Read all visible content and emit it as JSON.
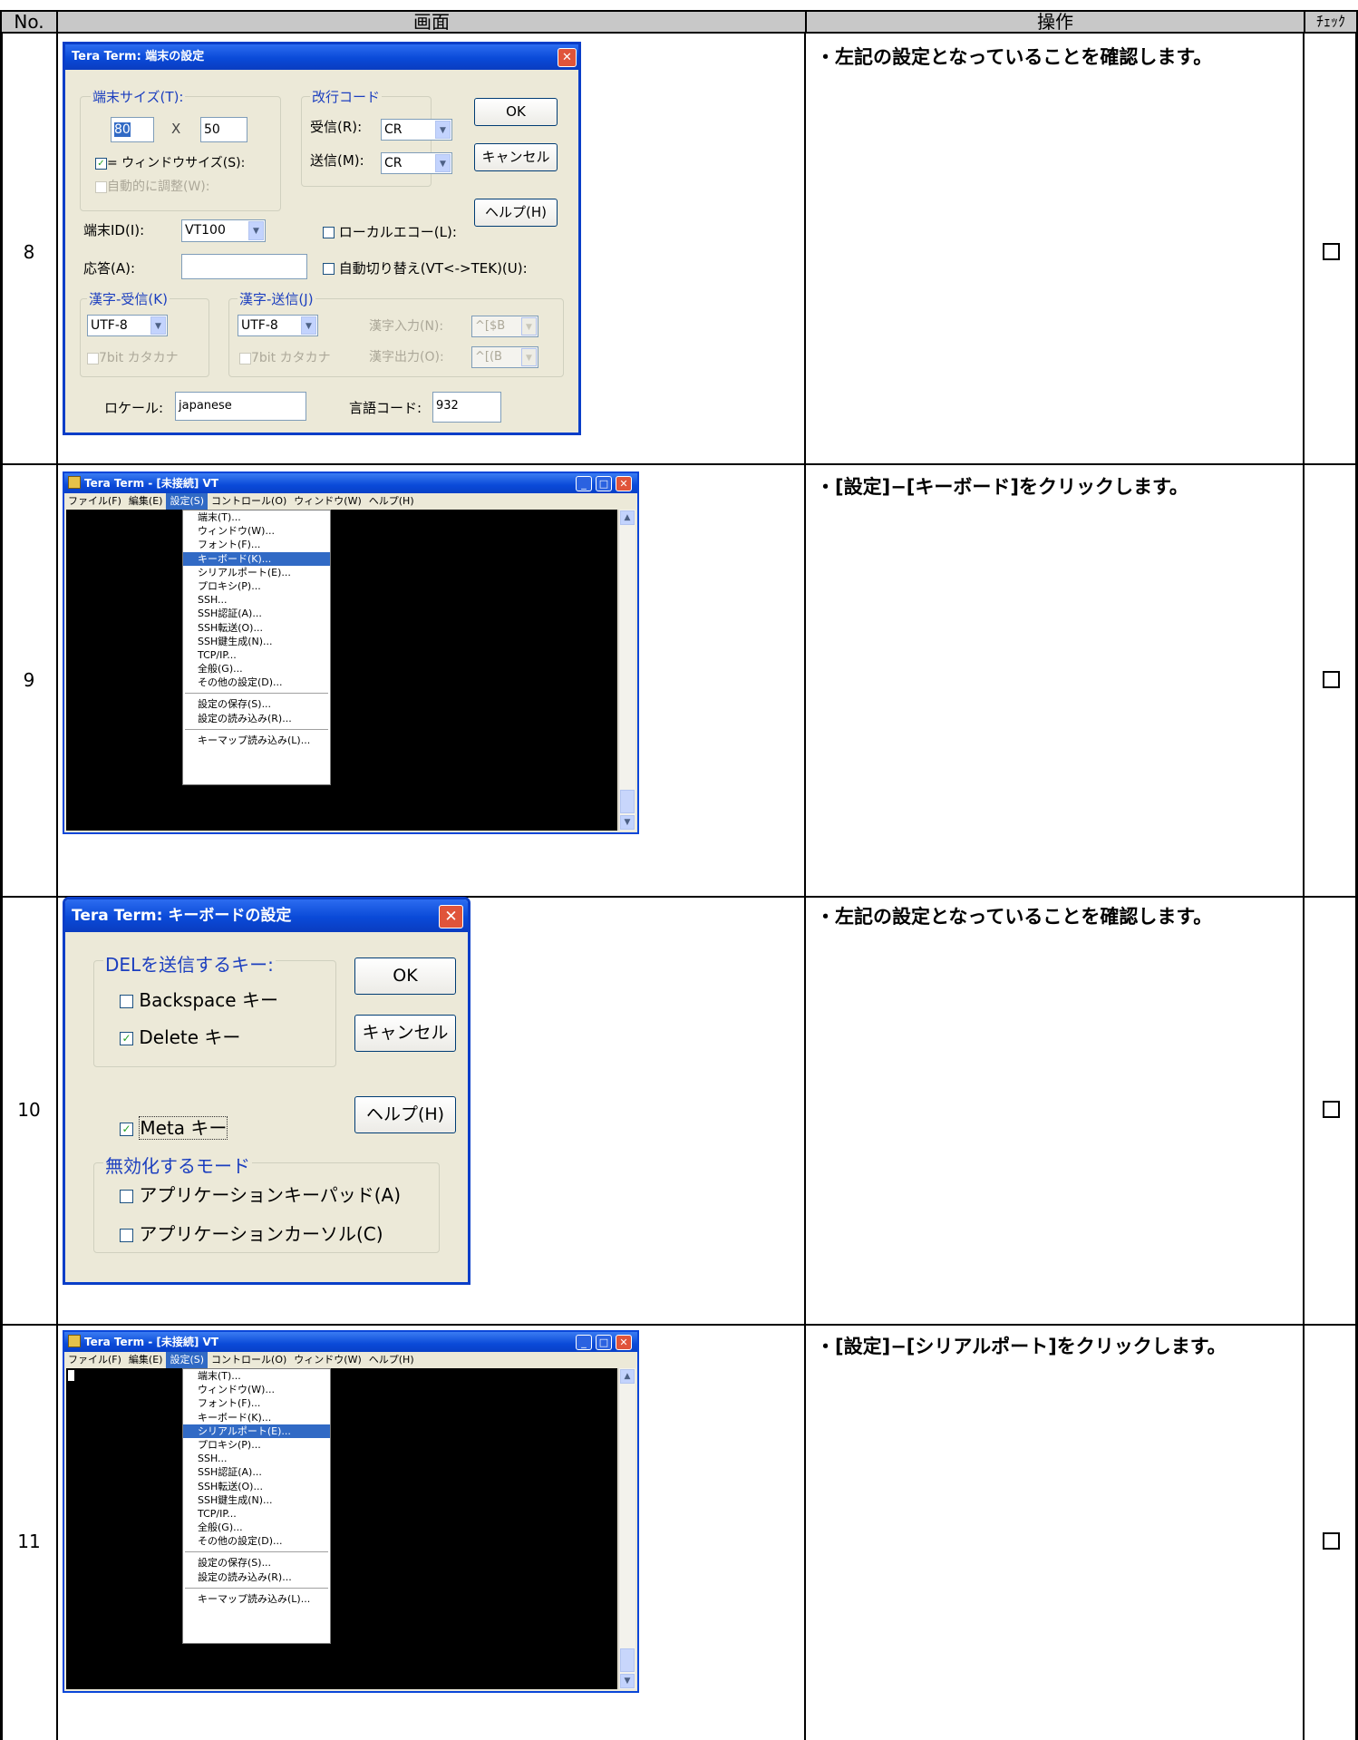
{
  "header": {
    "no": "No.",
    "screen": "画面",
    "operation": "操作",
    "check": "ﾁｪｯｸ"
  },
  "rows": [
    {
      "no": "8",
      "note": "・左記の設定となっていることを確認します。",
      "check": "□"
    },
    {
      "no": "9",
      "note": "・[設定]−[キーボード]をクリックします。",
      "check": "□"
    },
    {
      "no": "10",
      "note": "・左記の設定となっていることを確認します。",
      "check": "□"
    },
    {
      "no": "11",
      "note": "・[設定]−[シリアルポート]をクリックします。",
      "check": "□"
    }
  ],
  "terminal_dialog": {
    "title": "Tera Term: 端末の設定",
    "close": "✕",
    "size_group": "端末サイズ(T):",
    "cols": "80",
    "x": "X",
    "rows": "50",
    "eq_window": "= ウィンドウサイズ(S):",
    "auto_adjust": "自動的に調整(W):",
    "newline_group": "改行コード",
    "recv_label": "受信(R):",
    "recv_value": "CR",
    "send_label": "送信(M):",
    "send_value": "CR",
    "ok": "OK",
    "cancel": "キャンセル",
    "help": "ヘルプ(H)",
    "term_id_label": "端末ID(I):",
    "term_id_value": "VT100",
    "local_echo": "ローカルエコー(L):",
    "answer_label": "応答(A):",
    "answer_value": "",
    "auto_switch": "自動切り替え(VT<->TEK)(U):",
    "kanji_recv_group": "漢字-受信(K)",
    "kanji_recv_value": "UTF-8",
    "kanji_recv_7bit": "7bit カタカナ",
    "kanji_send_group": "漢字-送信(J)",
    "kanji_send_value": "UTF-8",
    "kanji_send_7bit": "7bit カタカナ",
    "kanji_in_label": "漢字入力(N):",
    "kanji_in_value": "^[$B",
    "kanji_out_label": "漢字出力(O):",
    "kanji_out_value": "^[(B",
    "locale_label": "ロケール:",
    "locale_value": "japanese",
    "langcode_label": "言語コード:",
    "langcode_value": "932"
  },
  "teraterm_window": {
    "title": "Tera Term - [未接続] VT",
    "menus": [
      "ファイル(F)",
      "編集(E)",
      "設定(S)",
      "コントロール(O)",
      "ウィンドウ(W)",
      "ヘルプ(H)"
    ],
    "setup_items_a": [
      "端末(T)...",
      "ウィンドウ(W)...",
      "フォント(F)...",
      "キーボード(K)...",
      "シリアルポート(E)...",
      "プロキシ(P)...",
      "SSH...",
      "SSH認証(A)...",
      "SSH転送(O)...",
      "SSH鍵生成(N)...",
      "TCP/IP...",
      "全般(G)...",
      "その他の設定(D)..."
    ],
    "setup_items_b": [
      "設定の保存(S)...",
      "設定の読み込み(R)..."
    ],
    "setup_items_c": [
      "キーマップ読み込み(L)..."
    ],
    "highlight_row9": "キーボード(K)...",
    "highlight_row11": "シリアルポート(E)..."
  },
  "keyboard_dialog": {
    "title": "Tera Term: キーボードの設定",
    "close": "✕",
    "del_group": "DELを送信するキー:",
    "backspace": "Backspace キー",
    "delete": "Delete キー",
    "meta": "Meta キー",
    "disable_group": "無効化するモード",
    "app_keypad": "アプリケーションキーパッド(A)",
    "app_cursor": "アプリケーションカーソル(C)",
    "ok": "OK",
    "cancel": "キャンセル",
    "help": "ヘルプ(H)"
  },
  "icons": {
    "check_mark": "check-icon",
    "dropdown": "chevron-down-icon"
  }
}
